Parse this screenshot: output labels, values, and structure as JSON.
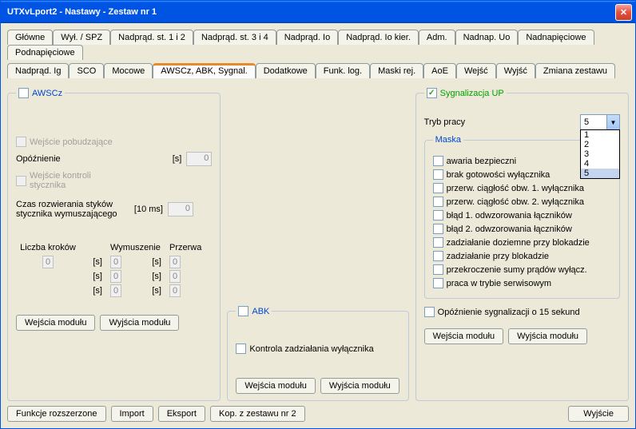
{
  "window": {
    "title": "UTXvLport2  -  Nastawy  -  Zestaw nr 1"
  },
  "tabs_row1": [
    "Główne",
    "Wył. / SPZ",
    "Nadprąd. st. 1 i 2",
    "Nadprąd. st. 3 i 4",
    "Nadprąd. Io",
    "Nadprąd. Io kier.",
    "Adm.",
    "Nadnap. Uo",
    "Nadnapięciowe",
    "Podnapięciowe"
  ],
  "tabs_row2": [
    "Nadprąd. Ig",
    "SCO",
    "Mocowe",
    "AWSCz, ABK, Sygnal.",
    "Dodatkowe",
    "Funk. log.",
    "Maski rej.",
    "AoE",
    "Wejść",
    "Wyjść",
    "Zmiana zestawu"
  ],
  "active_tab": "AWSCz, ABK, Sygnal.",
  "awscz": {
    "title": "AWSCz",
    "w_pobudz": "Wejście pobudzające",
    "opoznienie": "Opóźnienie",
    "opoznienie_unit": "[s]",
    "opoznienie_val": "0",
    "w_kontroli": "Wejście kontroli stycznika",
    "czas_roz": "Czas rozwierania styków stycznika wymuszającego",
    "czas_roz_unit": "[10 ms]",
    "czas_roz_val": "0",
    "hdr_liczba": "Liczba kroków",
    "hdr_wymusz": "Wymuszenie",
    "hdr_przerwa": "Przerwa",
    "liczba_val": "0",
    "u_s": "[s]",
    "vals": [
      "0",
      "0",
      "0",
      "0",
      "0",
      "0"
    ],
    "btn_in": "Wejścia modułu",
    "btn_out": "Wyjścia modułu"
  },
  "abk": {
    "title": "ABK",
    "kontrola": "Kontrola zadziałania wyłącznika",
    "btn_in": "Wejścia modułu",
    "btn_out": "Wyjścia modułu"
  },
  "syg": {
    "title": "Sygnalizacja UP",
    "tryb": "Tryb pracy",
    "tryb_val": "5",
    "options": [
      "1",
      "2",
      "3",
      "4",
      "5"
    ],
    "maska_title": "Maska",
    "maska_items": [
      "awaria bezpieczni",
      "brak gotowości wyłącznika",
      "przerw. ciągłość obw. 1. wyłącznika",
      "przerw. ciągłość obw. 2. wyłącznika",
      "błąd 1. odwzorowania łączników",
      "błąd 2. odwzorowania łączników",
      "zadziałanie doziemne przy blokadzie",
      "zadziałanie przy blokadzie",
      "przekroczenie sumy prądów wyłącz.",
      "praca w trybie serwisowym"
    ],
    "opozn": "Opóźnienie sygnalizacji o 15 sekund",
    "btn_in": "Wejścia modułu",
    "btn_out": "Wyjścia modułu"
  },
  "footer": {
    "funk": "Funkcje rozszerzone",
    "import": "Import",
    "eksport": "Eksport",
    "kop": "Kop. z zestawu nr 2",
    "wyjscie": "Wyjście"
  }
}
